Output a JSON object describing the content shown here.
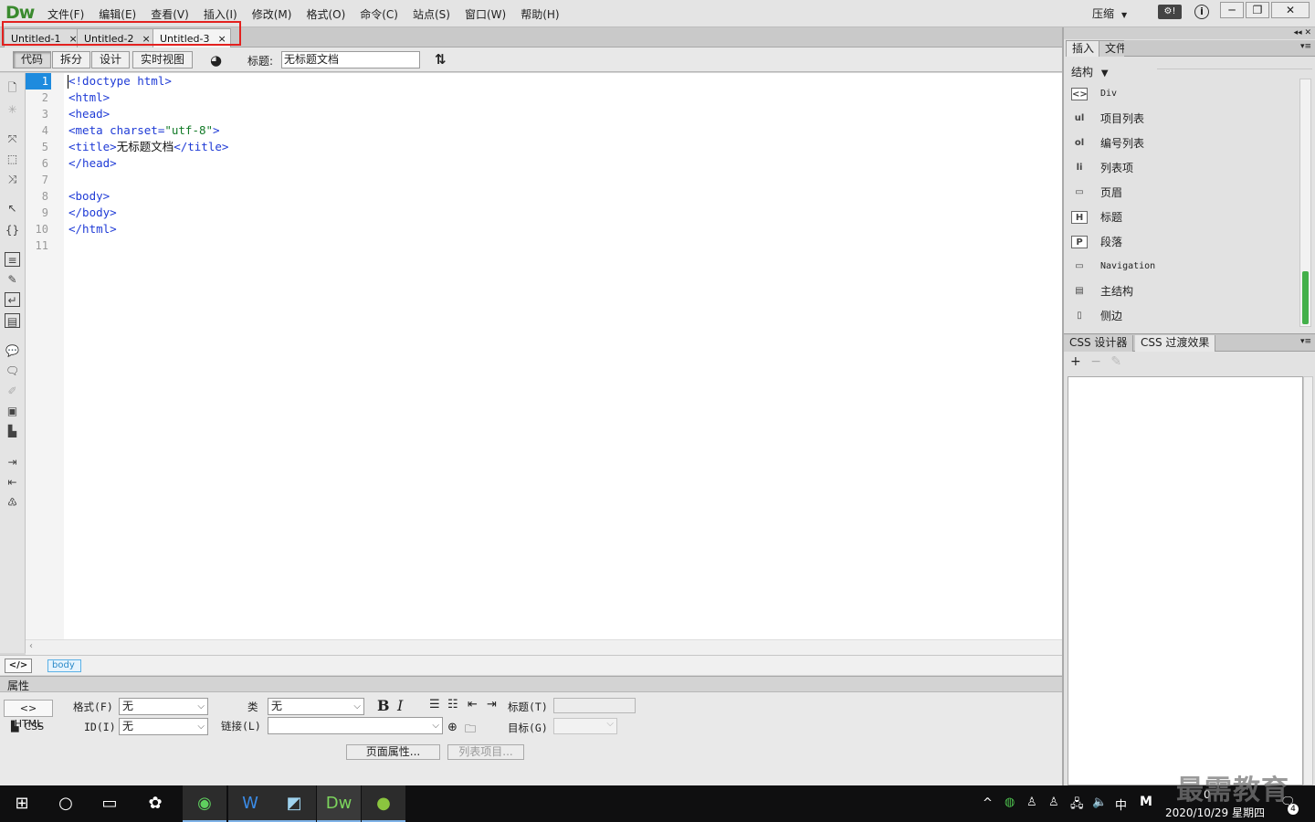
{
  "app": {
    "logo": "Dw",
    "menus": [
      "文件(F)",
      "编辑(E)",
      "查看(V)",
      "插入(I)",
      "修改(M)",
      "格式(O)",
      "命令(C)",
      "站点(S)",
      "窗口(W)",
      "帮助(H)"
    ],
    "compress_label": "压缩",
    "window_buttons": [
      "─",
      "❐",
      "✕"
    ]
  },
  "tabs": [
    {
      "label": "Untitled-1",
      "close": "×"
    },
    {
      "label": "Untitled-2",
      "close": "×"
    },
    {
      "label": "Untitled-3",
      "close": "×",
      "active": true
    }
  ],
  "doc_toolbar": {
    "views": [
      "代码",
      "拆分",
      "设计",
      "实时视图"
    ],
    "selected_view": "代码",
    "title_label": "标题:",
    "title_value": "无标题文档"
  },
  "editor": {
    "current_line": 1,
    "line_numbers": [
      "1",
      "2",
      "3",
      "4",
      "5",
      "6",
      "7",
      "8",
      "9",
      "10",
      "11"
    ],
    "lines": [
      [
        {
          "t": "<!doctype html>",
          "c": "tag"
        }
      ],
      [
        {
          "t": "<html>",
          "c": "tag"
        }
      ],
      [
        {
          "t": "<head>",
          "c": "tag"
        }
      ],
      [
        {
          "t": "<meta charset=",
          "c": "tag"
        },
        {
          "t": "\"utf-8\"",
          "c": "str"
        },
        {
          "t": ">",
          "c": "tag"
        }
      ],
      [
        {
          "t": "<title>",
          "c": "tag"
        },
        {
          "t": "无标题文档",
          "c": "txt"
        },
        {
          "t": "</title>",
          "c": "tag"
        }
      ],
      [
        {
          "t": "</head>",
          "c": "tag"
        }
      ],
      [],
      [
        {
          "t": "<body>",
          "c": "tag"
        }
      ],
      [
        {
          "t": "</body>",
          "c": "tag"
        }
      ],
      [
        {
          "t": "</html>",
          "c": "tag"
        }
      ],
      []
    ]
  },
  "status": {
    "code_icon": "</>",
    "tag": "body"
  },
  "properties": {
    "header": "属性",
    "html_btn": "<> HTML",
    "css_btn": "CSS",
    "format_label": "格式(F)",
    "format_value": "无",
    "id_label": "ID(I)",
    "id_value": "无",
    "class_label": "类",
    "class_value": "无",
    "link_label": "链接(L)",
    "link_value": "",
    "bold": "B",
    "italic": "I",
    "title_label": "标题(T)",
    "target_label": "目标(G)",
    "page_props_btn": "页面属性...",
    "list_item_btn": "列表项目..."
  },
  "right_panel": {
    "tabs": [
      "插入",
      "文件"
    ],
    "category": "结构",
    "items": [
      {
        "icon": "<>",
        "label": "Div"
      },
      {
        "icon": "ul",
        "label": "项目列表"
      },
      {
        "icon": "ol",
        "label": "编号列表"
      },
      {
        "icon": "li",
        "label": "列表项"
      },
      {
        "icon": "▭",
        "label": "页眉"
      },
      {
        "icon": "H",
        "label": "标题"
      },
      {
        "icon": "P",
        "label": "段落"
      },
      {
        "icon": "▭",
        "label": "Navigation"
      },
      {
        "icon": "▤",
        "label": "主结构"
      },
      {
        "icon": "▯",
        "label": "侧边"
      }
    ],
    "css_tabs": [
      "CSS 设计器",
      "CSS 过渡效果"
    ],
    "css_tools": [
      "+",
      "−",
      "✎"
    ]
  },
  "taskbar": {
    "date": "2020/10/29 星期四",
    "time": "0",
    "ime": "中",
    "notif_count": "4"
  },
  "watermark": "最需教育"
}
